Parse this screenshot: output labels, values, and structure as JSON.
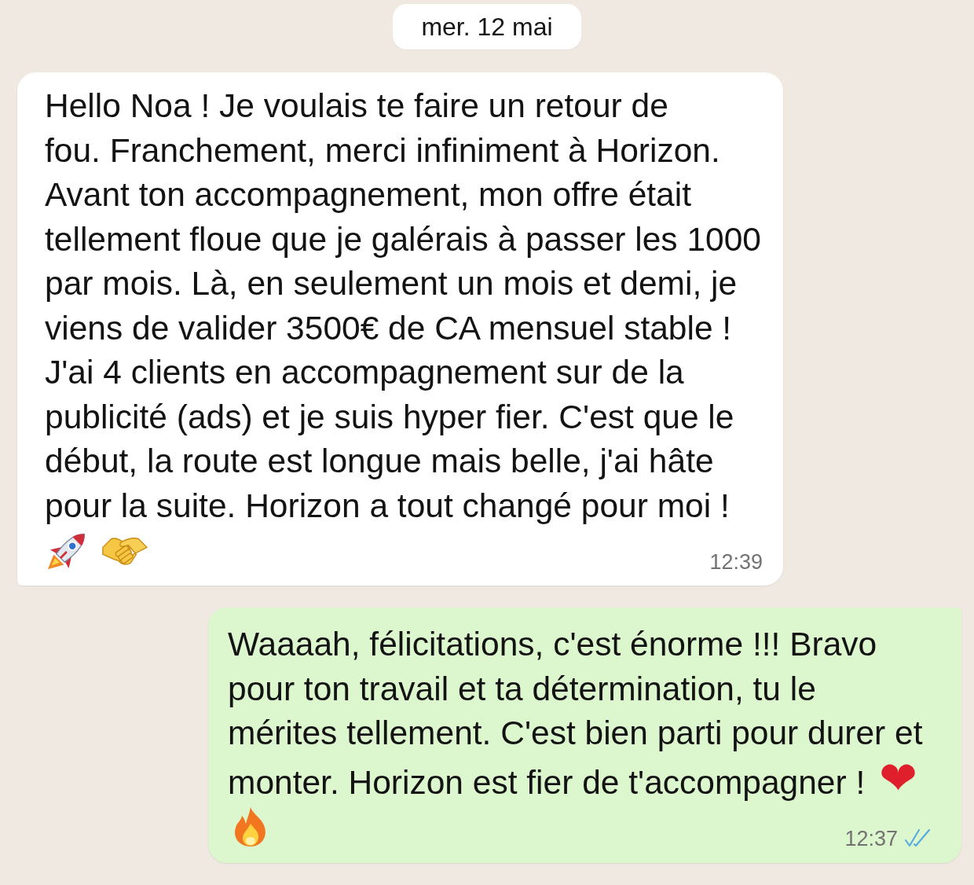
{
  "date_chip": "mer. 12 mai",
  "messages": [
    {
      "kind": "incoming",
      "text": "Hello Noa ! Je voulais te faire un retour de\nfou. Franchement, merci infiniment à Horizon. Avant ton accompagnement, mon offre était tellement floue que je galérais à passer les 1000 par mois. Là, en seulement un mois et demi, je viens de valider 3500€ de CA mensuel stable ! J'ai 4 clients en accompagnement sur de la publicité (ads) et je suis hyper fier. C'est que le début, la route est longue mais belle, j'ai hâte pour la suite. Horizon a tout changé pour moi !",
      "time": "12:39"
    },
    {
      "kind": "outgoing",
      "text": "Waaaah, félicitations, c'est énorme !!! Bravo pour ton travail et ta détermination, tu le mérites tellement. C'est bien parti pour durer et monter. Horizon est fier de t'accompagner !",
      "trailing_emoji": "❤",
      "time": "12:37",
      "read": true
    }
  ]
}
